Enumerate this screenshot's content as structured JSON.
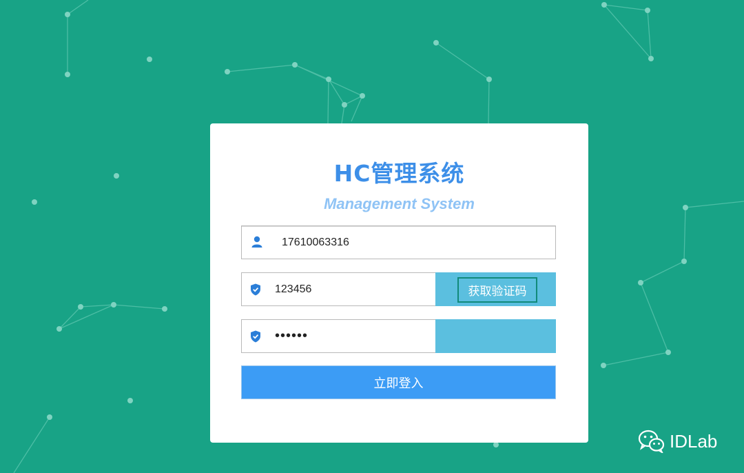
{
  "app": {
    "title": "HC管理系统",
    "subtitle": "Management System"
  },
  "form": {
    "username": {
      "value": "17610063316",
      "icon": "user-icon"
    },
    "code": {
      "value": "123456",
      "icon": "shield-icon",
      "button_label": "获取验证码"
    },
    "password": {
      "value": "••••••",
      "icon": "shield-icon"
    },
    "submit_label": "立即登入"
  },
  "watermark": {
    "text": "IDLab",
    "icon": "wechat-icon"
  },
  "colors": {
    "background": "#18a386",
    "primary": "#3c9cf5",
    "side_panel": "#5bbfdf",
    "title": "#3d8fe8"
  }
}
